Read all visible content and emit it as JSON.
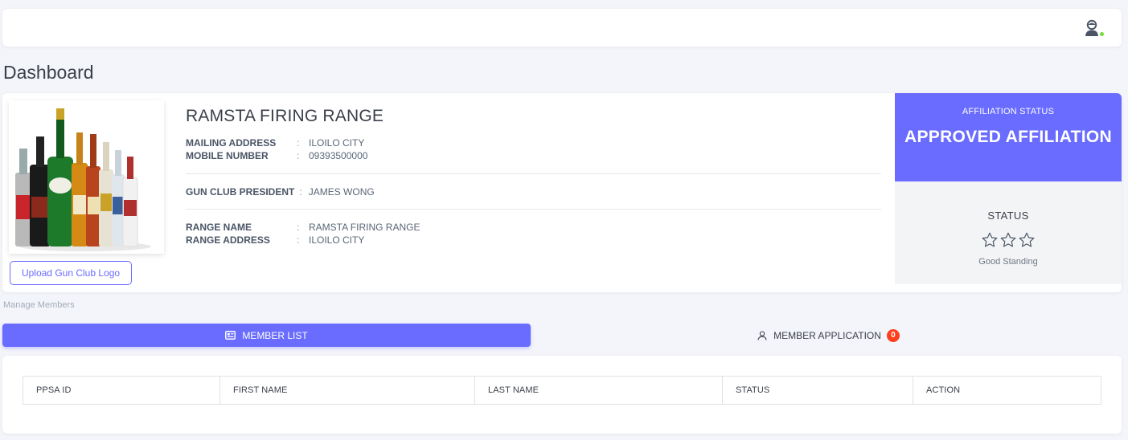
{
  "topbar": {
    "avatar_icon": "user-avatar-icon",
    "online_color": "#71dd37"
  },
  "page": {
    "title": "Dashboard"
  },
  "club": {
    "name": "RAMSTA FIRING RANGE",
    "upload_logo_label": "Upload Gun Club Logo",
    "fields": {
      "mailing_address": {
        "label": "MAILING ADDRESS",
        "value": "ILOILO CITY"
      },
      "mobile_number": {
        "label": "MOBILE NUMBER",
        "value": "09393500000"
      },
      "president": {
        "label": "GUN CLUB PRESIDENT",
        "value": "JAMES WONG"
      },
      "range_name": {
        "label": "RANGE NAME",
        "value": "RAMSTA FIRING RANGE"
      },
      "range_address": {
        "label": "RANGE ADDRESS",
        "value": "ILOILO CITY"
      }
    },
    "separator": ":"
  },
  "affiliation": {
    "label": "AFFILIATION STATUS",
    "value": "APPROVED AFFILIATION",
    "color": "#696cff"
  },
  "status": {
    "label": "STATUS",
    "stars_filled": 0,
    "stars_total": 3,
    "standing": "Good Standing"
  },
  "members": {
    "section_label": "Manage Members",
    "tabs": [
      {
        "label": "MEMBER LIST",
        "icon": "id-card-icon",
        "active": true
      },
      {
        "label": "MEMBER APPLICATION",
        "icon": "user-icon",
        "active": false,
        "badge": "0"
      }
    ],
    "table": {
      "columns": [
        "PPSA ID",
        "FIRST NAME",
        "LAST NAME",
        "STATUS",
        "ACTION"
      ],
      "rows": []
    }
  }
}
